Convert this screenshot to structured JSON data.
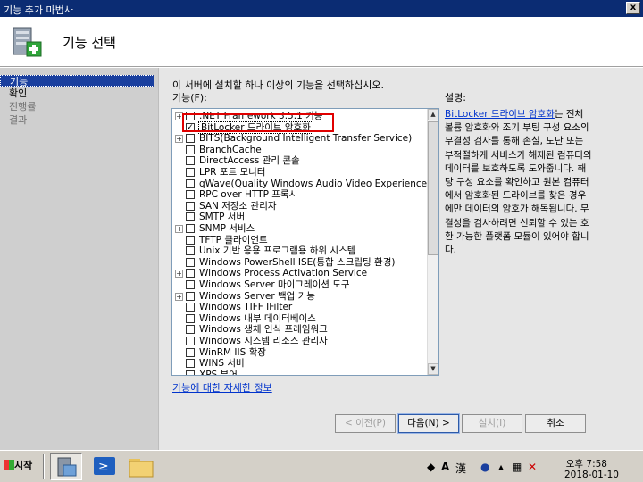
{
  "window": {
    "title": "기능 추가 마법사",
    "close_glyph": "x"
  },
  "header": {
    "title": "기능 선택"
  },
  "nav": {
    "items": [
      "기능",
      "확인",
      "진행률",
      "결과"
    ]
  },
  "main": {
    "instruction": "이 서버에 설치할 하나 이상의 기능을 선택하십시오.",
    "features_label": "기능(F):",
    "description_label": "설명:",
    "features": [
      {
        "label": ".NET Framework 3.5.1 기능",
        "expander": true,
        "checked": false
      },
      {
        "label": "BitLocker 드라이브 암호화",
        "expander": false,
        "checked": true,
        "selected": true
      },
      {
        "label": "BITS(Background Intelligent Transfer Service)",
        "expander": true,
        "checked": false
      },
      {
        "label": "BranchCache",
        "expander": false,
        "checked": false
      },
      {
        "label": "DirectAccess 관리 콘솔",
        "expander": false,
        "checked": false
      },
      {
        "label": "LPR 포트 모니터",
        "expander": false,
        "checked": false
      },
      {
        "label": "qWave(Quality Windows Audio Video Experience)",
        "expander": false,
        "checked": false
      },
      {
        "label": "RPC over HTTP 프록시",
        "expander": false,
        "checked": false
      },
      {
        "label": "SAN 저장소 관리자",
        "expander": false,
        "checked": false
      },
      {
        "label": "SMTP 서버",
        "expander": false,
        "checked": false
      },
      {
        "label": "SNMP 서비스",
        "expander": true,
        "checked": false
      },
      {
        "label": "TFTP 클라이언트",
        "expander": false,
        "checked": false
      },
      {
        "label": "Unix 기반 응용 프로그램용 하위 시스템",
        "expander": false,
        "checked": false
      },
      {
        "label": "Windows PowerShell ISE(통합 스크립팅 환경)",
        "expander": false,
        "checked": false
      },
      {
        "label": "Windows Process Activation Service",
        "expander": true,
        "checked": false
      },
      {
        "label": "Windows Server 마이그레이션 도구",
        "expander": false,
        "checked": false
      },
      {
        "label": "Windows Server 백업 기능",
        "expander": true,
        "checked": false
      },
      {
        "label": "Windows TIFF IFilter",
        "expander": false,
        "checked": false
      },
      {
        "label": "Windows 내부 데이터베이스",
        "expander": false,
        "checked": false
      },
      {
        "label": "Windows 생체 인식 프레임워크",
        "expander": false,
        "checked": false
      },
      {
        "label": "Windows 시스템 리소스 관리자",
        "expander": false,
        "checked": false
      },
      {
        "label": "WinRM IIS 확장",
        "expander": false,
        "checked": false
      },
      {
        "label": "WINS 서버",
        "expander": false,
        "checked": false
      },
      {
        "label": "XPS 뷰어",
        "expander": false,
        "checked": false
      }
    ],
    "description_link": "BitLocker 드라이브 암호화",
    "description_text": "는 전체 볼륨 암호화와 조기 부팅 구성 요소의 무결성 검사를 통해 손실, 도난 또는 부적절하게 서비스가 해제된 컴퓨터의 데이터를 보호하도록 도와줍니다. 해당 구성 요소를 확인하고 원본 컴퓨터에서 암호화된 드라이브를 찾은 경우에만 데이터의 암호가 해독됩니다. 무결성을 검사하려면 신뢰할 수 있는 호환 가능한 플랫폼 모듈이 있어야 합니다.",
    "more_info_link": "기능에 대한 자세한 정보",
    "buttons": {
      "prev": "< 이전(P)",
      "next": "다음(N) >",
      "install": "설치(I)",
      "cancel": "취소"
    }
  },
  "taskbar": {
    "start_label": "시작",
    "clock_time": "오후 7:58",
    "clock_date": "2018-01-10",
    "ime": {
      "a": "A",
      "han": "漢"
    }
  }
}
